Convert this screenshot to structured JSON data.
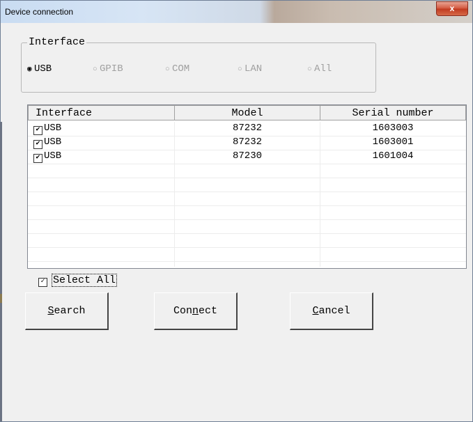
{
  "window": {
    "title": "Device connection",
    "close_label": "x"
  },
  "interface_group": {
    "legend": "Interface",
    "options": [
      {
        "label": "USB",
        "selected": true,
        "enabled": true
      },
      {
        "label": "GPIB",
        "selected": false,
        "enabled": false
      },
      {
        "label": "COM",
        "selected": false,
        "enabled": false
      },
      {
        "label": "LAN",
        "selected": false,
        "enabled": false
      },
      {
        "label": "All",
        "selected": false,
        "enabled": false
      }
    ]
  },
  "device_table": {
    "columns": [
      "Interface",
      "Model",
      "Serial number"
    ],
    "rows": [
      {
        "checked": true,
        "interface": "USB",
        "model": "87232",
        "serial": "1603003"
      },
      {
        "checked": true,
        "interface": "USB",
        "model": "87232",
        "serial": "1603001"
      },
      {
        "checked": true,
        "interface": "USB",
        "model": "87230",
        "serial": "1601004"
      }
    ]
  },
  "select_all": {
    "label": "Select All",
    "checked": true
  },
  "buttons": {
    "search": "Search",
    "connect": "Connect",
    "cancel": "Cancel"
  },
  "colors": {
    "titlebar": "#d7e5f5",
    "close": "#c0391e",
    "dialog_bg": "#f0f0f0"
  }
}
